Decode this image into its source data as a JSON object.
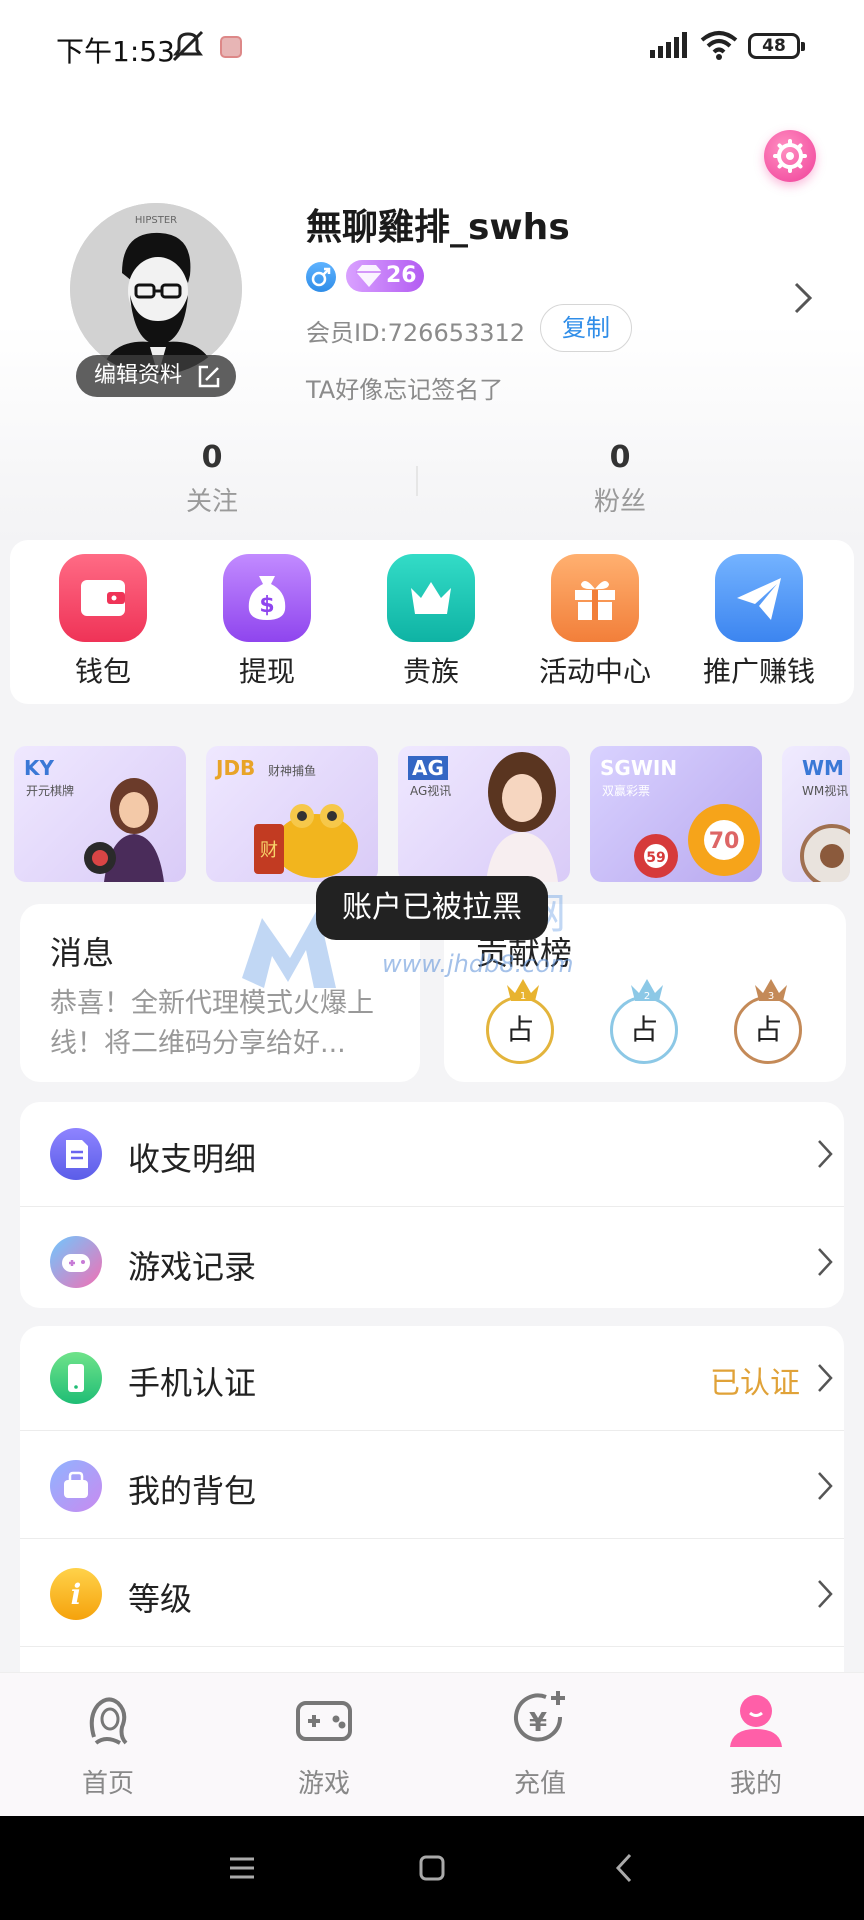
{
  "status_bar": {
    "time": "下午1:53",
    "battery": "48"
  },
  "profile": {
    "username": "無聊雞排_swhs",
    "vip_level": "26",
    "member_id": "会员ID:726653312",
    "copy_label": "复制",
    "edit_label": "编辑资料",
    "signature": "TA好像忘记签名了",
    "avatar_text": "HIPSTER"
  },
  "stats": [
    {
      "value": "0",
      "label": "关注"
    },
    {
      "value": "0",
      "label": "粉丝"
    }
  ],
  "actions": [
    {
      "label": "钱包",
      "icon": "wallet-icon",
      "color": "#f34a6b"
    },
    {
      "label": "提现",
      "icon": "money-bag-icon",
      "color": "#a35cf0"
    },
    {
      "label": "贵族",
      "icon": "crown-icon",
      "color": "#18c7b6"
    },
    {
      "label": "活动中心",
      "icon": "gift-icon",
      "color": "#f89a4c"
    },
    {
      "label": "推广赚钱",
      "icon": "paper-plane-icon",
      "color": "#4d94f5"
    }
  ],
  "games": [
    {
      "title": "KY",
      "subtitle": "开元棋牌"
    },
    {
      "title": "JDB",
      "subtitle": "财神捕鱼"
    },
    {
      "title": "AG",
      "subtitle": "AG视讯"
    },
    {
      "title": "SGWIN",
      "subtitle": "双赢彩票"
    },
    {
      "title": "WM",
      "subtitle": "WM视讯"
    }
  ],
  "messages": {
    "title": "消息",
    "text": "恭喜！全新代理模式火爆上线！将二维码分享给好..."
  },
  "ranking": {
    "title": "贡献榜",
    "slots": [
      "占",
      "占",
      "占"
    ]
  },
  "toast": "账户已被拉黑",
  "watermark": {
    "text": "鉴黑担保网",
    "url": "www.jhdb8.com"
  },
  "menu_group1": [
    {
      "label": "收支明细",
      "icon": "document-icon"
    },
    {
      "label": "游戏记录",
      "icon": "gamepad-icon"
    }
  ],
  "menu_group2": [
    {
      "label": "手机认证",
      "icon": "phone-icon",
      "status": "已认证"
    },
    {
      "label": "我的背包",
      "icon": "backpack-icon"
    },
    {
      "label": "等级",
      "icon": "info-icon"
    }
  ],
  "bottom_nav": [
    {
      "label": "首页",
      "icon": "home-icon"
    },
    {
      "label": "游戏",
      "icon": "gamepad-icon"
    },
    {
      "label": "充值",
      "icon": "recharge-icon"
    },
    {
      "label": "我的",
      "icon": "profile-icon"
    }
  ]
}
